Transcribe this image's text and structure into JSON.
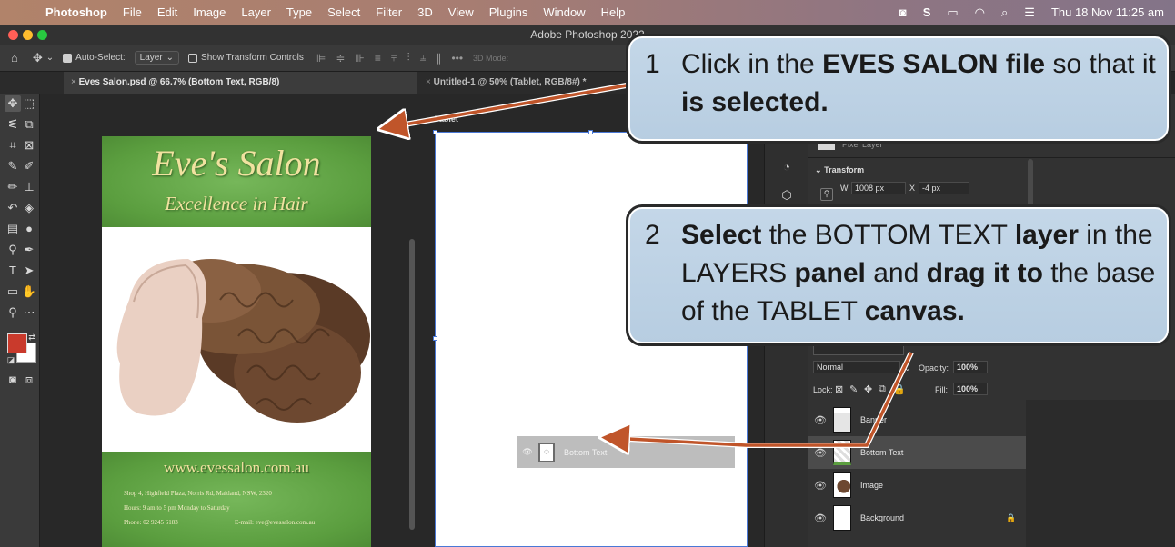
{
  "menubar": {
    "app": "Photoshop",
    "items": [
      "File",
      "Edit",
      "Image",
      "Layer",
      "Type",
      "Select",
      "Filter",
      "3D",
      "View",
      "Plugins",
      "Window",
      "Help"
    ],
    "clock": "Thu 18 Nov  11:25 am"
  },
  "window": {
    "title": "Adobe Photoshop 2022"
  },
  "optionsbar": {
    "auto_select_label": "Auto-Select:",
    "auto_select_value": "Layer",
    "transform_label": "Show Transform Controls",
    "mode_3d": "3D Mode:",
    "more": "•••"
  },
  "tabs": [
    {
      "label": "Eves Salon.psd @ 66.7% (Bottom Text, RGB/8)"
    },
    {
      "label": "Untitled-1 @ 50% (Tablet, RGB/8#) *"
    }
  ],
  "poster": {
    "title": "Eve's Salon",
    "subtitle": "Excellence in Hair",
    "url": "www.evessalon.com.au",
    "address": "Shop 4, Highfield Plaza, Norris Rd, Maitland, NSW, 2320",
    "hours": "Hours:  9 am to 5 pm Monday to Saturday",
    "phone": "Phone:  02 9245 6183",
    "email": "E-mail:  eve@evessalon.com.au"
  },
  "tablet": {
    "label": "Tablet"
  },
  "drag_chip": {
    "label": "Bottom Text"
  },
  "properties": {
    "pixel_layer": "Pixel Layer",
    "transform_title": "Transform",
    "w_label": "W",
    "w_value": "1008 px",
    "x_label": "X",
    "x_value": "-4 px"
  },
  "layers": {
    "blend_mode": "Normal",
    "opacity_label": "Opacity:",
    "opacity_value": "100%",
    "lock_label": "Lock:",
    "fill_label": "Fill:",
    "fill_value": "100%",
    "items": [
      {
        "name": "Banner"
      },
      {
        "name": "Bottom Text"
      },
      {
        "name": "Image"
      },
      {
        "name": "Background"
      }
    ]
  },
  "callouts": [
    {
      "num": "1",
      "text_a": "Click in the ",
      "bold_a": "EVES SALON file",
      "text_b": " so that it ",
      "bold_b": "is selected."
    },
    {
      "num": "2",
      "bold_a": "Select",
      "text_a": " the BOTTOM TEXT ",
      "bold_b": "layer",
      "text_b": " in the LAYERS ",
      "bold_c": "panel",
      "text_c": " and ",
      "bold_d": "drag it to",
      "text_d": " the base of the TABLET ",
      "bold_e": "canvas."
    }
  ],
  "colors": {
    "poster_green": "#5b9e3f",
    "poster_gold": "#f1e2a0",
    "callout_blue": "#c4d7e8",
    "arrow": "#c0552a",
    "foreground_swatch": "#c93a2c"
  }
}
